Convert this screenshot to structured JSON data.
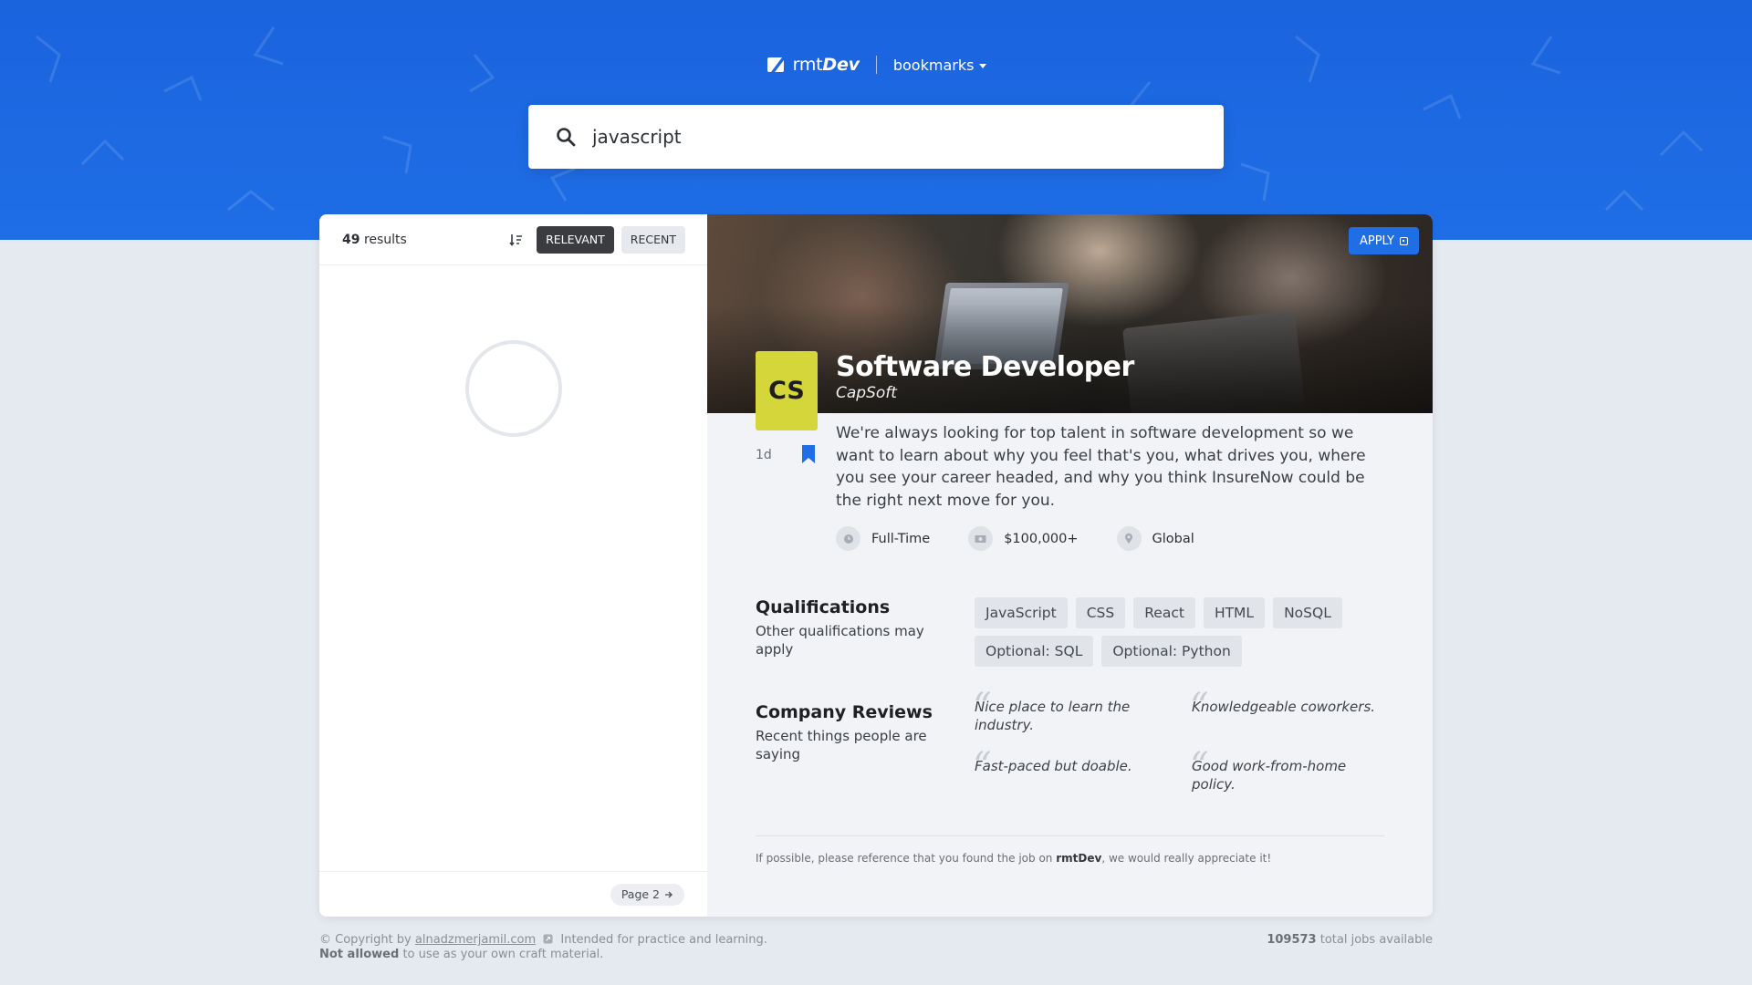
{
  "header": {
    "logo_prefix": "rmt",
    "logo_suffix": "Dev",
    "bookmarks_label": "bookmarks"
  },
  "search": {
    "value": "javascript"
  },
  "sidebar": {
    "results_count": "49",
    "results_label": "results",
    "sort_relevant": "RELEVANT",
    "sort_recent": "RECENT",
    "page_button": "Page 2"
  },
  "job": {
    "apply_label": "APPLY",
    "badge": "CS",
    "title": "Software Developer",
    "company": "CapSoft",
    "age": "1d",
    "description": "We're always looking for top talent in software development so we want to learn about why you feel that's you, what drives you, where you see your career headed, and why you think InsureNow could be the right next move for you.",
    "meta": {
      "duration": "Full-Time",
      "salary": "$100,000+",
      "location": "Global"
    },
    "qualifications": {
      "title": "Qualifications",
      "subtitle": "Other qualifications may apply",
      "tags": [
        "JavaScript",
        "CSS",
        "React",
        "HTML",
        "NoSQL",
        "Optional: SQL",
        "Optional: Python"
      ]
    },
    "reviews": {
      "title": "Company Reviews",
      "subtitle": "Recent things people are saying",
      "items": [
        "Nice place to learn the industry.",
        "Knowledgeable coworkers.",
        "Fast-paced but doable.",
        "Good work-from-home policy."
      ]
    },
    "note_prefix": "If possible, please reference that you found the job on",
    "note_brand": "rmtDev",
    "note_suffix": ", we would really appreciate it!"
  },
  "footer": {
    "copyright_prefix": "© Copyright by",
    "copyright_link": "alnadzmerjamil.com",
    "copyright_suffix": "Intended for practice and learning.",
    "not_allowed": "Not allowed",
    "not_allowed_suffix": "to use as your own craft material.",
    "total_jobs": "109573",
    "total_jobs_label": "total jobs available"
  },
  "colors": {
    "accent": "#1f6ee6",
    "badge": "#d4d63a",
    "dark_button": "#3a3c40"
  },
  "icons": [
    "logo-icon",
    "chevron-down-icon",
    "search-icon",
    "sort-icon",
    "arrow-right-icon",
    "external-link-icon",
    "bookmark-icon",
    "clock-icon",
    "money-icon",
    "location-icon",
    "quote-icon"
  ]
}
